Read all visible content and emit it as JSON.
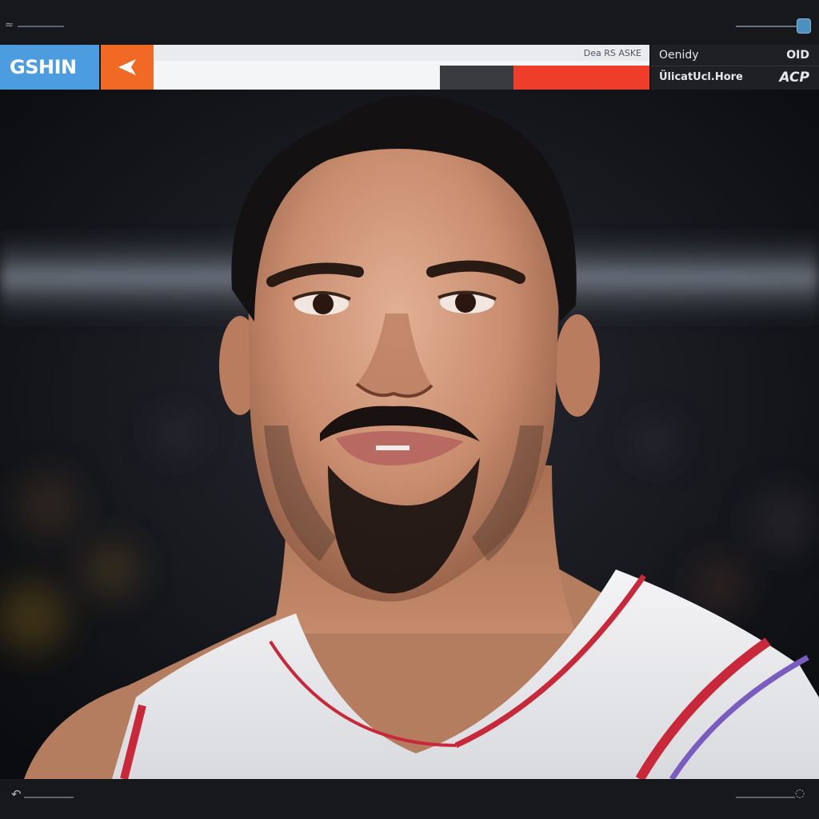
{
  "window": {
    "top_left_glyph": "≈",
    "bottom_left_glyph": "↶",
    "bottom_right_glyph": "◌",
    "slider_icon": "slider-thumb"
  },
  "scoreboard": {
    "brand_label": "GSHIN",
    "back_icon": "back-arrow-icon",
    "caption": "Dea RS ASKE",
    "rows": [
      {
        "label": "Oenidy",
        "value": "OID"
      },
      {
        "label": "ÜlicatUcl.Hore",
        "value": "ACP"
      }
    ]
  },
  "colors": {
    "brand": "#4b9de0",
    "accent": "#f06a26",
    "red_bar": "#ef3d2b",
    "dark_bar": "#3a3b3f",
    "panel_bg": "#1f2024"
  },
  "photo": {
    "subject": "athlete-portrait"
  }
}
